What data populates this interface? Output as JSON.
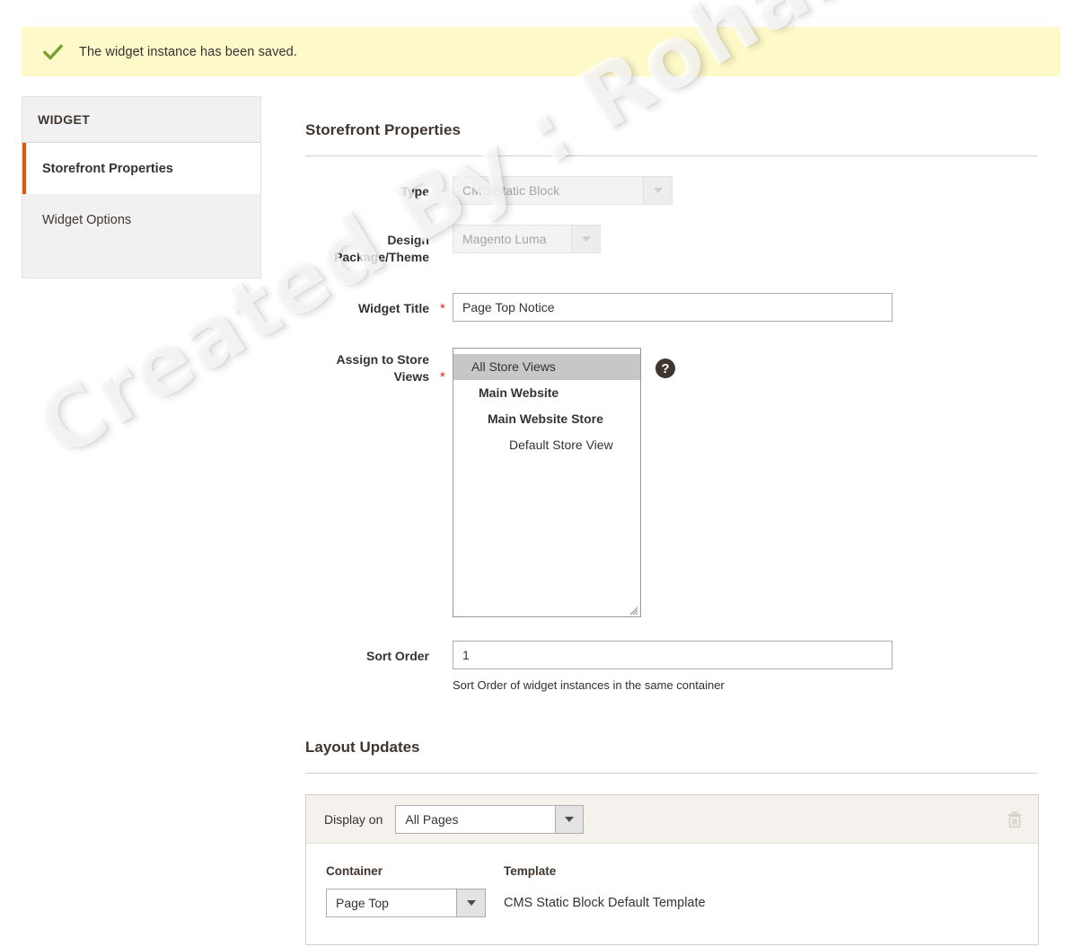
{
  "banner": {
    "icon": "check-icon",
    "message": "The widget instance has been saved."
  },
  "sidebar": {
    "heading": "WIDGET",
    "items": [
      {
        "label": "Storefront Properties",
        "active": true
      },
      {
        "label": "Widget Options",
        "active": false
      }
    ]
  },
  "storefront": {
    "section_title": "Storefront Properties",
    "type": {
      "label": "Type",
      "value": "CMS Static Block",
      "disabled": true
    },
    "design_theme": {
      "label": "Design Package/Theme",
      "value": "Magento Luma",
      "disabled": true
    },
    "widget_title": {
      "label": "Widget Title",
      "required": "*",
      "value": "Page Top Notice"
    },
    "store_views": {
      "label": "Assign to Store Views",
      "required": "*",
      "help_icon": "question-mark-icon",
      "options": [
        {
          "label": "All Store Views",
          "level": 0,
          "selected": true
        },
        {
          "label": "Main Website",
          "level": 1,
          "selected": false
        },
        {
          "label": "Main Website Store",
          "level": 2,
          "selected": false
        },
        {
          "label": "Default Store View",
          "level": 3,
          "selected": false
        }
      ]
    },
    "sort_order": {
      "label": "Sort Order",
      "value": "1",
      "hint": "Sort Order of widget instances in the same container"
    }
  },
  "layout_updates": {
    "section_title": "Layout Updates",
    "display_on": {
      "label": "Display on",
      "value": "All Pages"
    },
    "delete_icon": "trash-icon",
    "columns": {
      "container_header": "Container",
      "template_header": "Template"
    },
    "container": {
      "value": "Page Top"
    },
    "template": {
      "value": "CMS Static Block Default Template"
    }
  },
  "watermark": {
    "text": "Created By : Rohan Hapani"
  },
  "colors": {
    "banner_bg": "#fdf9c9",
    "check_green": "#79a22e",
    "accent_orange": "#eb5202",
    "required_red": "#e22626",
    "panel_tan": "#d6cfc5",
    "lu_head_bg": "#f5f1ed"
  }
}
